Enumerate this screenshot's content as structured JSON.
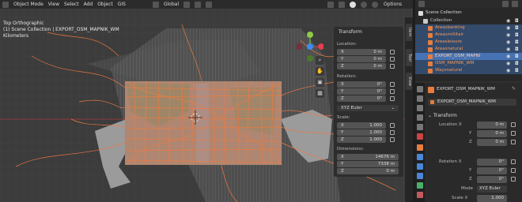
{
  "header": {
    "mode": "Object Mode",
    "menus": [
      "View",
      "Select",
      "Add",
      "Object",
      "GIS"
    ],
    "orientation": "Global",
    "options": "Options"
  },
  "overlay": {
    "view_name": "Top Orthographic",
    "collection_info": "(1) Scene Collection | EXPORT_OSM_MAPNIK_WM",
    "units": "Kilometers"
  },
  "npanel": {
    "title": "Transform",
    "location_label": "Location:",
    "location": [
      {
        "k": "X",
        "v": "0 m"
      },
      {
        "k": "Y",
        "v": "0 m"
      },
      {
        "k": "Z",
        "v": "0 m"
      }
    ],
    "rotation_label": "Rotation:",
    "rotation": [
      {
        "k": "X",
        "v": "0°"
      },
      {
        "k": "Y",
        "v": "0°"
      },
      {
        "k": "Z",
        "v": "0°"
      }
    ],
    "rotation_mode": "XYZ Euler",
    "scale_label": "Scale:",
    "scale": [
      {
        "k": "X",
        "v": "1.000"
      },
      {
        "k": "Y",
        "v": "1.000"
      },
      {
        "k": "Z",
        "v": "1.000"
      }
    ],
    "dimensions_label": "Dimensions:",
    "dimensions": [
      {
        "k": "X",
        "v": "14676 m"
      },
      {
        "k": "Y",
        "v": "7338 m"
      },
      {
        "k": "Z",
        "v": "0 m"
      }
    ]
  },
  "sidetabs": [
    "Item",
    "Tool",
    "View"
  ],
  "outliner": {
    "root": "Scene Collection",
    "items": [
      {
        "label": "Collection",
        "color": "#c9c9c9",
        "selected": false
      },
      {
        "label": "Areasbanking",
        "color": "#e87d3e",
        "selected": true
      },
      {
        "label": "Areasmililtair",
        "color": "#e87d3e",
        "selected": true
      },
      {
        "label": "Areasleisure",
        "color": "#e87d3e",
        "selected": true
      },
      {
        "label": "Areasnatural",
        "color": "#e87d3e",
        "selected": true
      },
      {
        "label": "EXPORT_OSM_MAPNI",
        "color": "#e87d3e",
        "selected": true,
        "active": true
      },
      {
        "label": "OSM_MAPNIK_WM",
        "color": "#e87d3e",
        "selected": true
      },
      {
        "label": "Waysnatural",
        "color": "#e87d3e",
        "selected": true
      }
    ]
  },
  "properties": {
    "object_name": "EXPORT_OSM_MAPNIK_WM",
    "object_field": "EXPORT_OSM_MAPNIK_WM",
    "transform_title": "Transform",
    "location_x_label": "Location X",
    "location": [
      {
        "k": "",
        "v": "0 m"
      },
      {
        "k": "Y",
        "v": "0 m"
      },
      {
        "k": "Z",
        "v": "0 m"
      }
    ],
    "rotation_x_label": "Rotation X",
    "rotation": [
      {
        "k": "",
        "v": "0°"
      },
      {
        "k": "Y",
        "v": "0°"
      },
      {
        "k": "Z",
        "v": "0°"
      }
    ],
    "mode_label": "Mode",
    "mode_value": "XYZ Euler",
    "scale_x_label": "Scale X",
    "scale_x_value": "1.000"
  },
  "colors": {
    "accent": "#4772b3",
    "selection_orange": "#e87d3e",
    "map_orange": "#f07a40",
    "map_gray": "#9b9b9b"
  }
}
